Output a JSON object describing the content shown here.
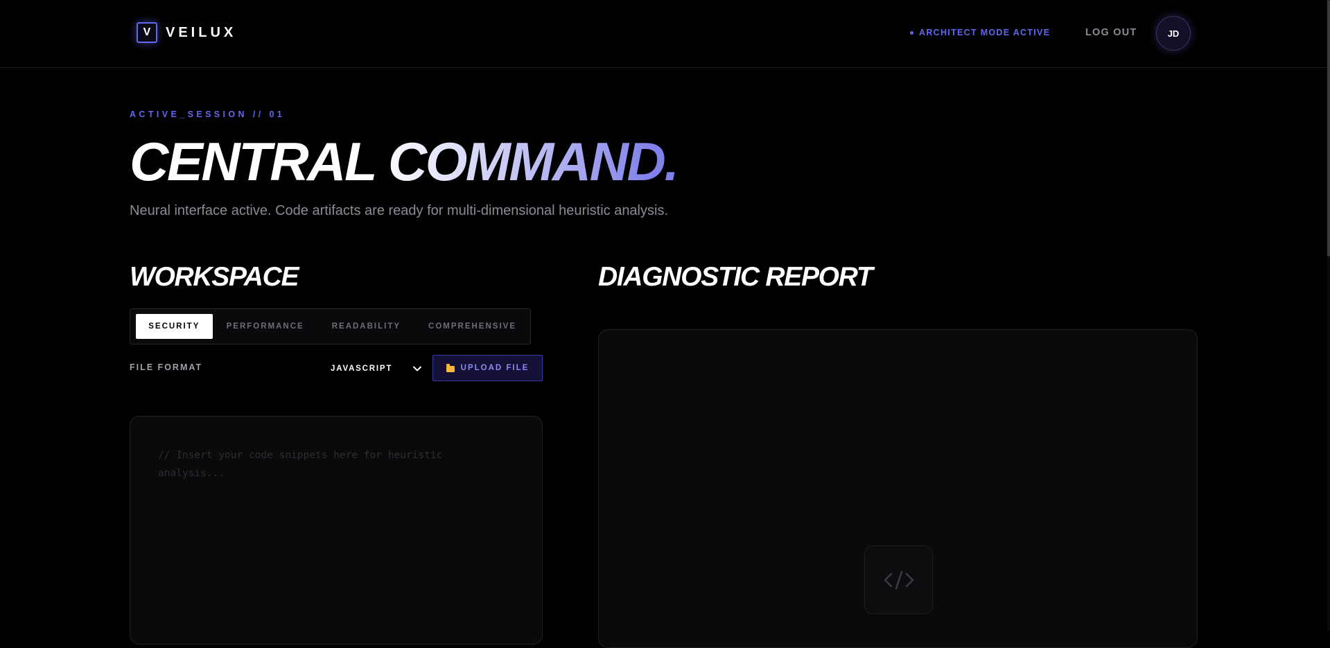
{
  "brand": {
    "mark": "V",
    "name": "VEILUX"
  },
  "nav": {
    "mode_status": "ARCHITECT MODE ACTIVE",
    "logout_label": "LOG OUT",
    "avatar_initials": "JD"
  },
  "hero": {
    "session_label": "ACTIVE_SESSION // 01",
    "title": "CENTRAL COMMAND.",
    "subtitle": "Neural interface active. Code artifacts are ready for multi-dimensional heuristic analysis."
  },
  "workspace": {
    "title": "WORKSPACE",
    "tabs": [
      {
        "label": "SECURITY",
        "active": true
      },
      {
        "label": "PERFORMANCE",
        "active": false
      },
      {
        "label": "READABILITY",
        "active": false
      },
      {
        "label": "COMPREHENSIVE",
        "active": false
      }
    ],
    "file_format_label": "FILE FORMAT",
    "language_selected": "JAVASCRIPT",
    "upload_label": "UPLOAD FILE",
    "editor_placeholder": "// Insert your code snippets here for heuristic analysis..."
  },
  "report": {
    "title": "DIAGNOSTIC REPORT",
    "empty_icon": "code-icon"
  },
  "colors": {
    "accent": "#6366f1",
    "upload_bg": "#141036",
    "folder": "#f5b83d",
    "muted": "#8b8b95"
  }
}
